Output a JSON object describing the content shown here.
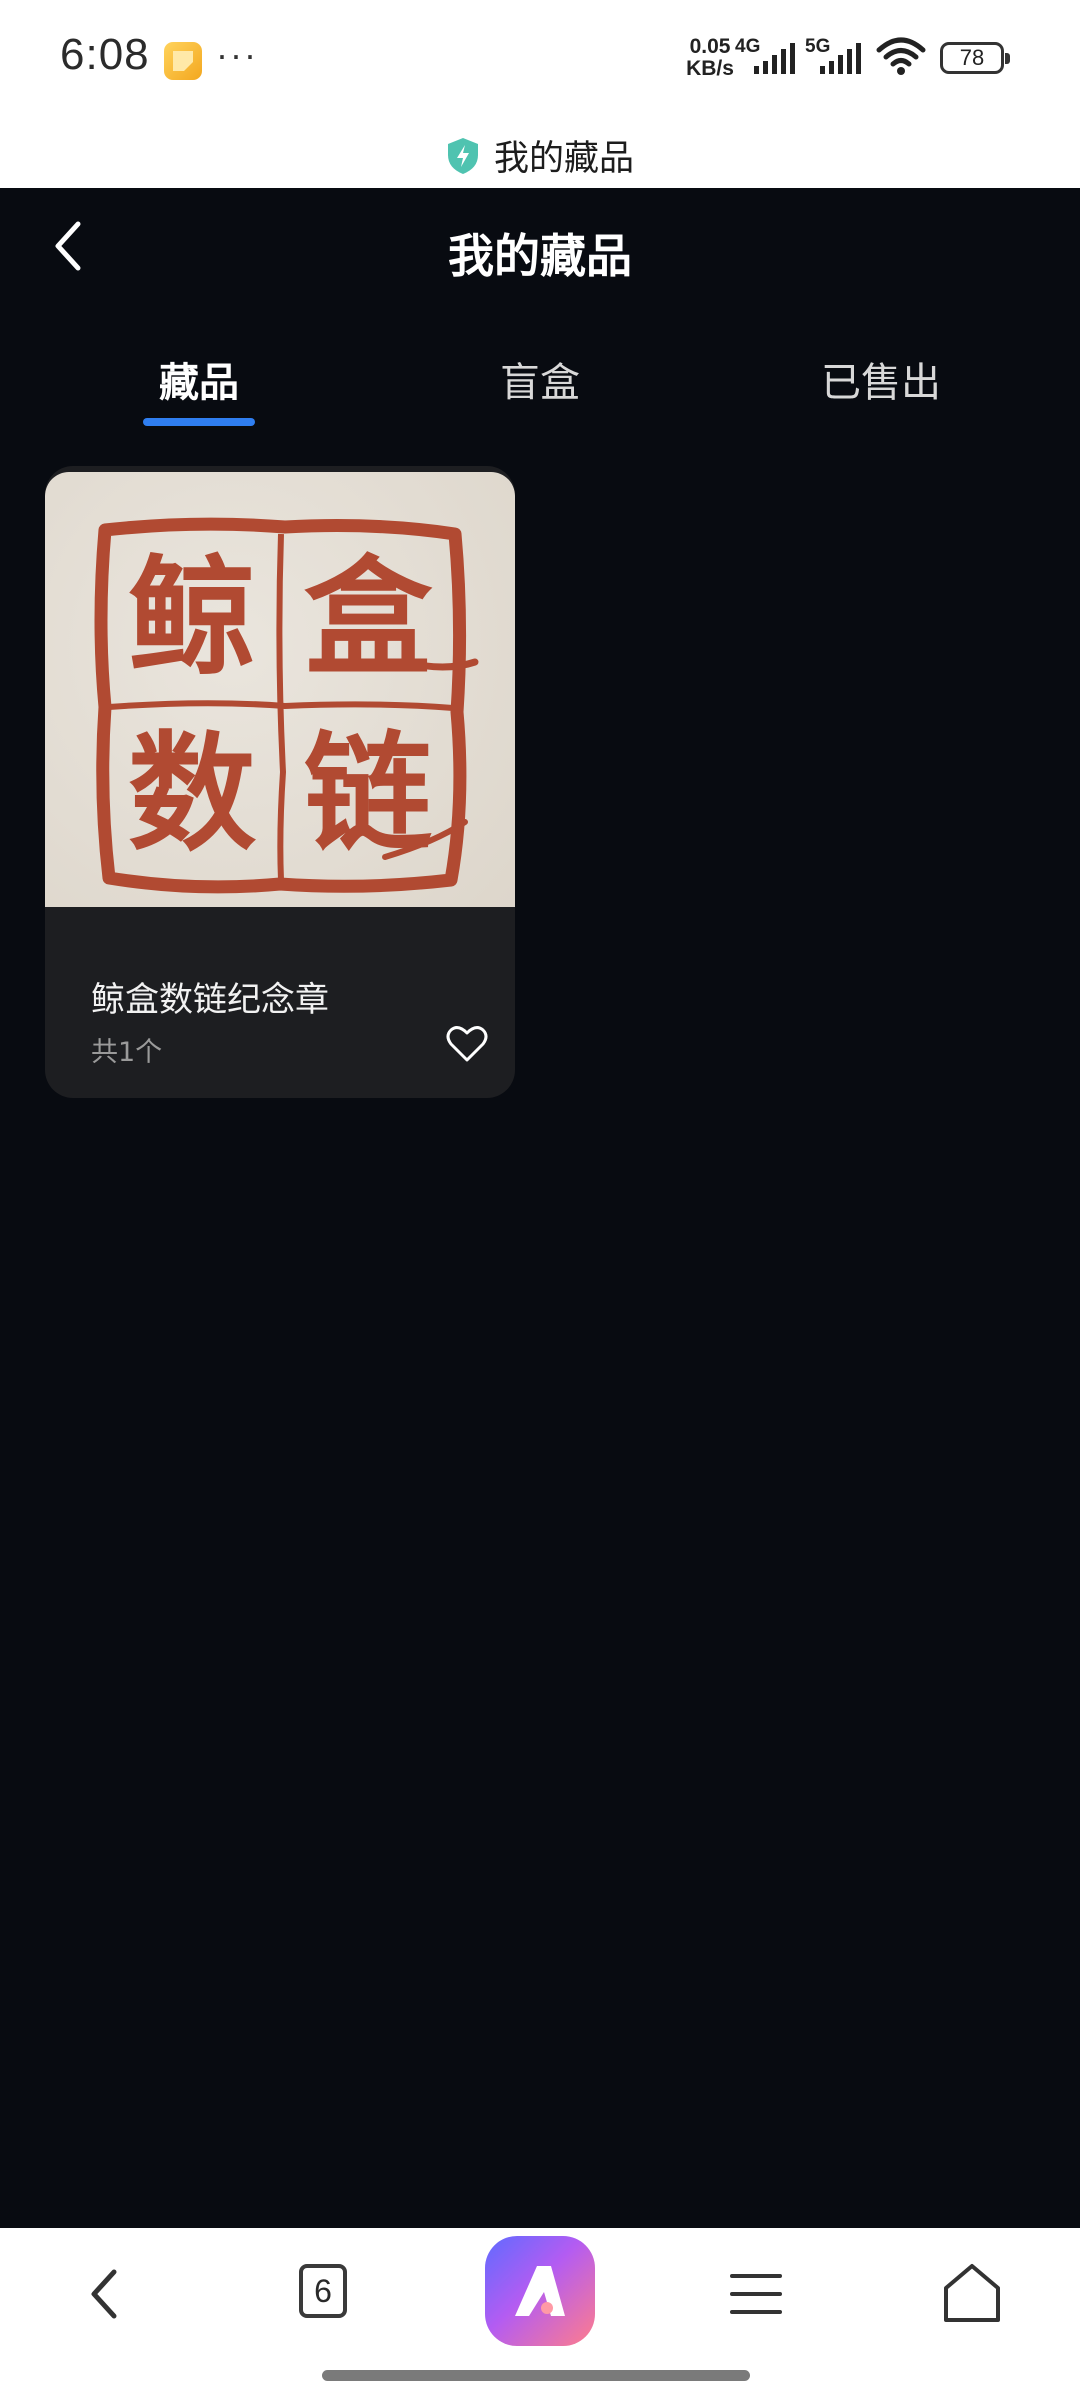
{
  "status_bar": {
    "time": "6:08",
    "more": "···",
    "speed_value": "0.05",
    "speed_unit": "KB/s",
    "network_1": "4G",
    "network_2": "5G",
    "battery": "78"
  },
  "browser": {
    "page_title": "我的藏品",
    "tab_count": "6"
  },
  "header": {
    "title": "我的藏品"
  },
  "tabs": [
    {
      "label": "藏品",
      "active": true
    },
    {
      "label": "盲盒",
      "active": false
    },
    {
      "label": "已售出",
      "active": false
    }
  ],
  "items": [
    {
      "name": "鲸盒数链纪念章",
      "count": "共1个",
      "seal_chars": [
        "鲸",
        "盒",
        "数",
        "链"
      ]
    }
  ],
  "colors": {
    "background": "#080b11",
    "card": "#1d1e21",
    "accent": "#2f7ef0",
    "seal_red": "#b14a32"
  }
}
